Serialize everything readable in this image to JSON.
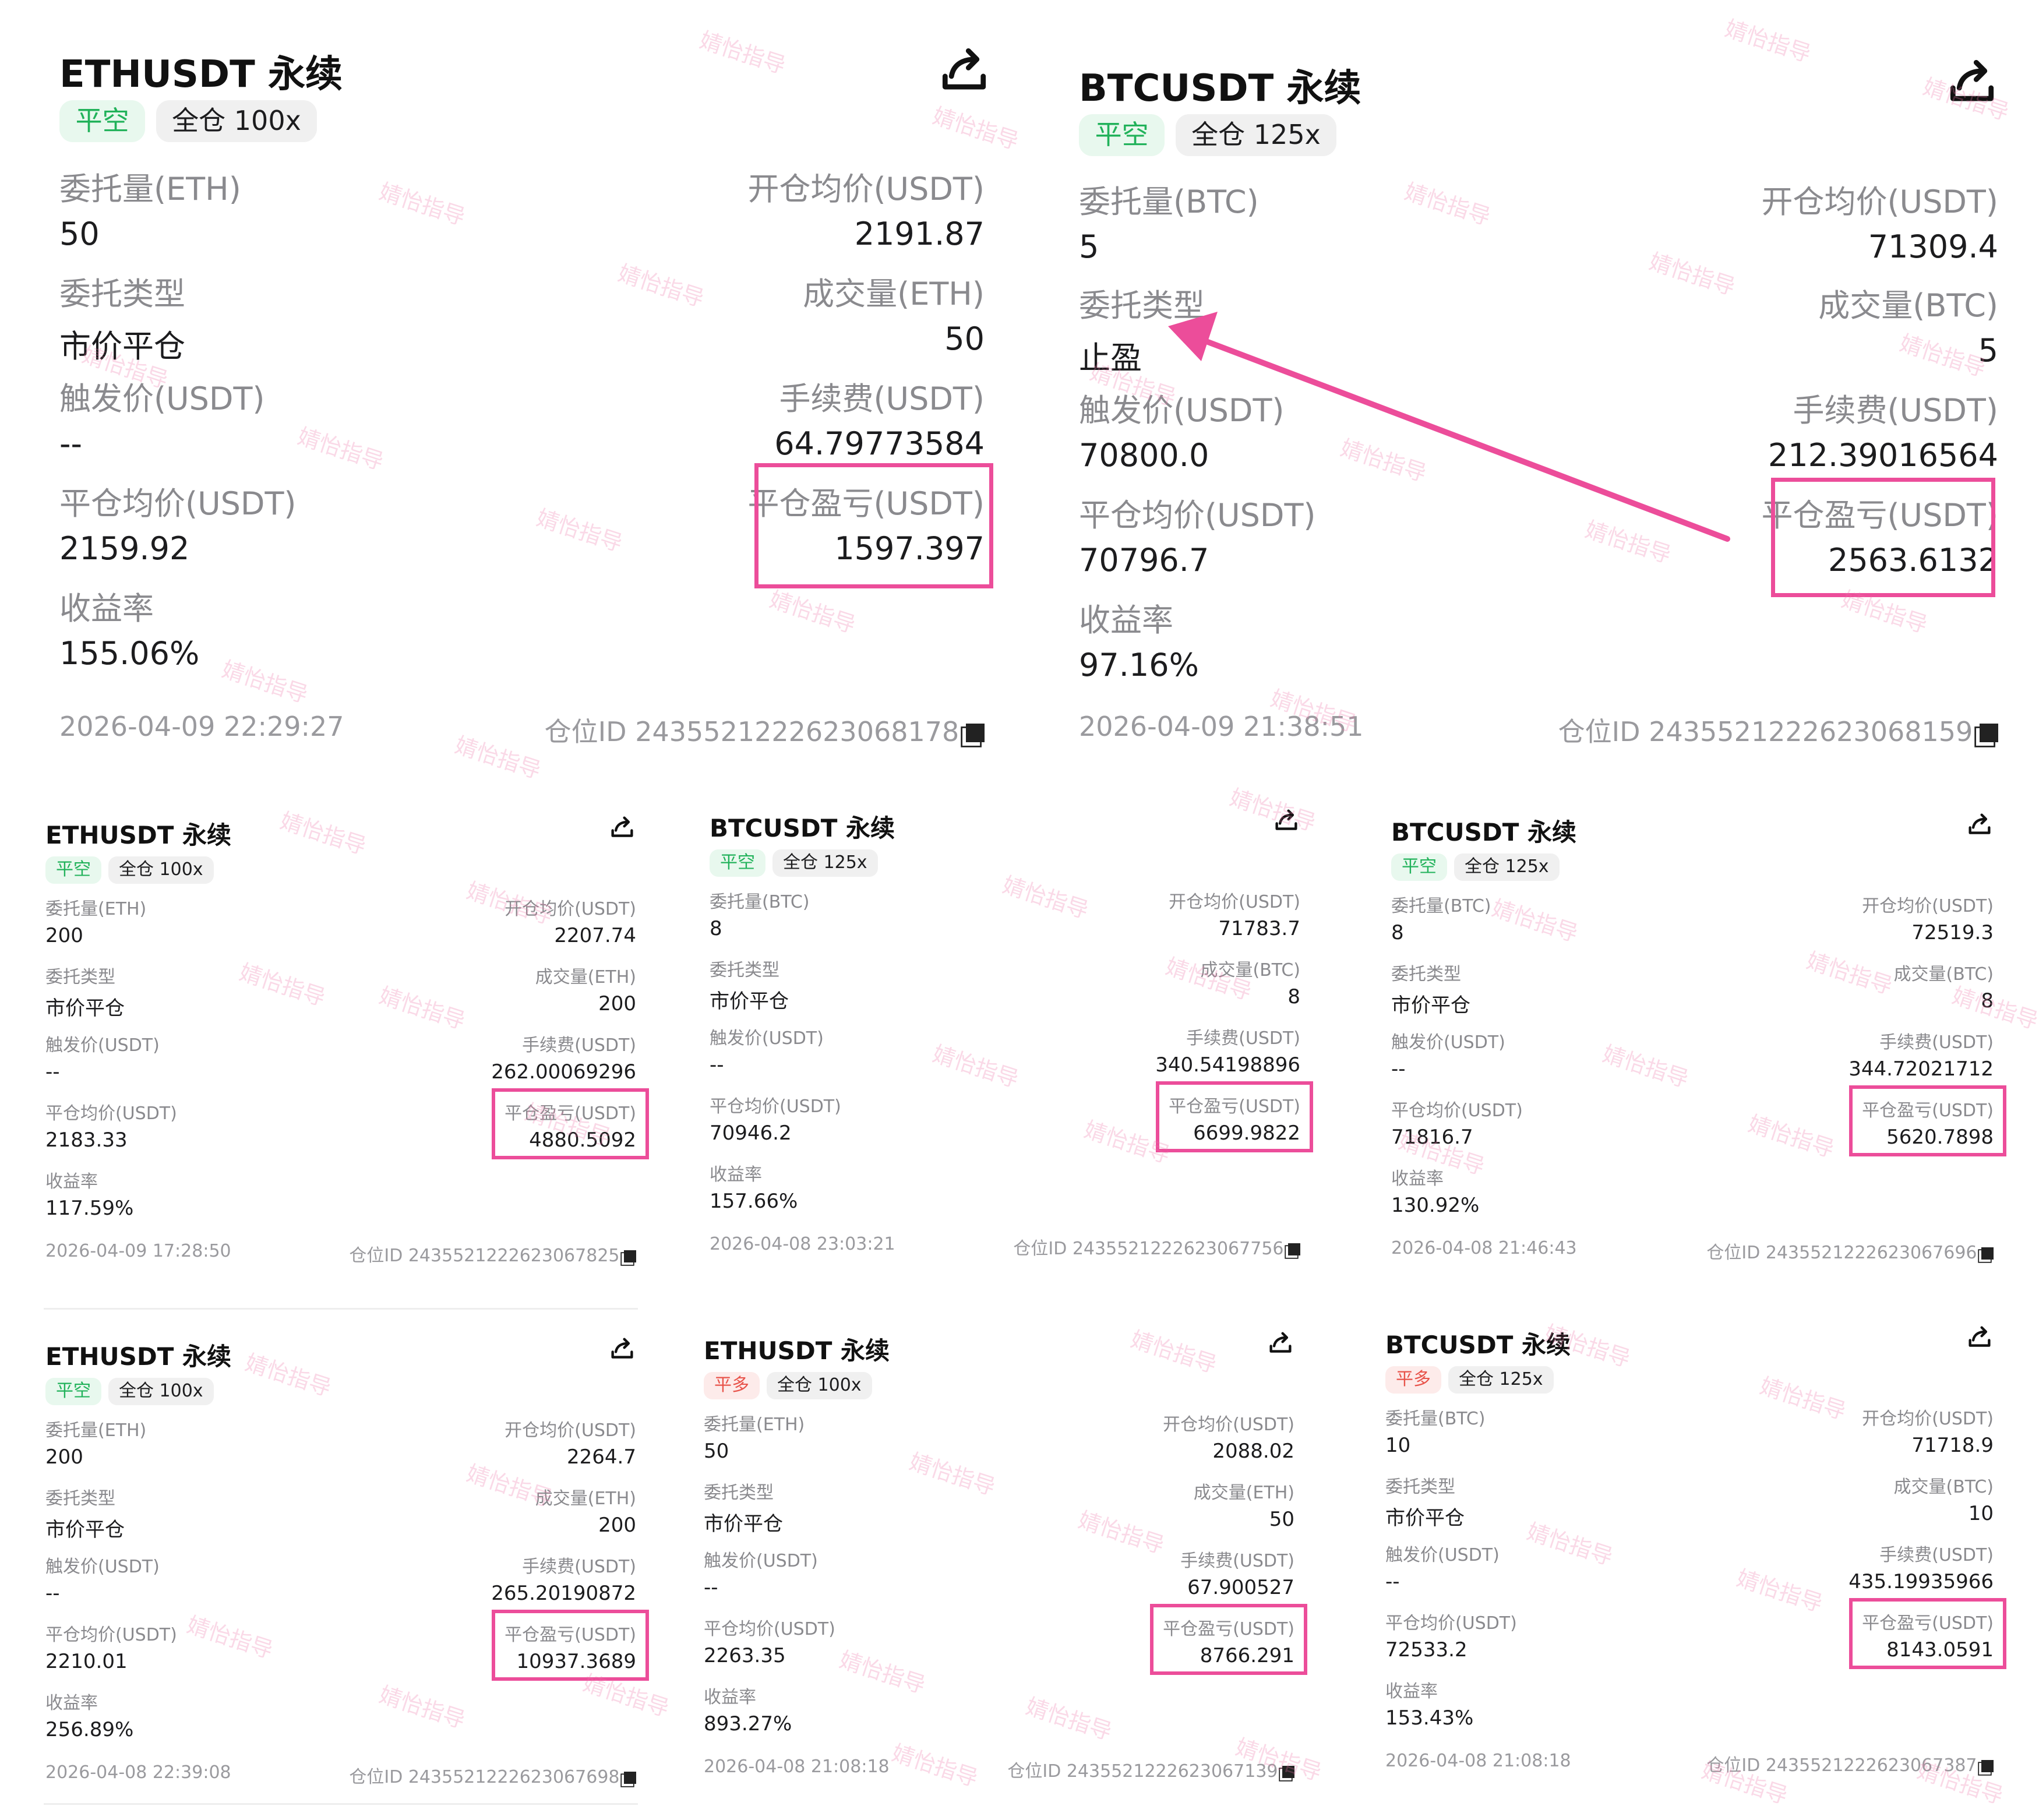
{
  "common": {
    "labels": {
      "qty_eth": "委托量(ETH)",
      "qty_btc": "委托量(BTC)",
      "order_type": "委托类型",
      "trigger_price": "触发价(USDT)",
      "close_avg": "平仓均价(USDT)",
      "roi": "收益率",
      "open_avg": "开仓均价(USDT)",
      "filled_eth": "成交量(ETH)",
      "filled_btc": "成交量(BTC)",
      "fee": "手续费(USDT)",
      "pnl": "平仓盈亏(USDT)"
    },
    "position_id_prefix": "仓位ID",
    "watermark": "婧怡指导",
    "colors": {
      "highlight": "#ec4d9a",
      "short_green": "#21b25a",
      "long_red": "#e8534a"
    },
    "icons": [
      "share-icon",
      "copy-icon",
      "arrow-annotation"
    ]
  },
  "cards": [
    {
      "title": "ETHUSDT 永续",
      "side": "平空",
      "margin": "全仓 100x",
      "qty": "50",
      "order_type": "市价平仓",
      "trigger": "--",
      "close_avg": "2159.92",
      "roi": "155.06%",
      "open_avg": "2191.87",
      "filled": "50",
      "fee": "64.79773584",
      "pnl": "1597.397",
      "timestamp": "2026-04-09 22:29:27",
      "position_id": "2435521222623068178"
    },
    {
      "title": "BTCUSDT 永续",
      "side": "平空",
      "margin": "全仓 125x",
      "qty": "5",
      "order_type": "止盈",
      "trigger": "70800.0",
      "close_avg": "70796.7",
      "roi": "97.16%",
      "open_avg": "71309.4",
      "filled": "5",
      "fee": "212.39016564",
      "pnl": "2563.6132",
      "timestamp": "2026-04-09 21:38:51",
      "position_id": "2435521222623068159"
    },
    {
      "title": "ETHUSDT 永续",
      "side": "平空",
      "margin": "全仓 100x",
      "qty": "200",
      "order_type": "市价平仓",
      "trigger": "--",
      "close_avg": "2183.33",
      "roi": "117.59%",
      "open_avg": "2207.74",
      "filled": "200",
      "fee": "262.00069296",
      "pnl": "4880.5092",
      "timestamp": "2026-04-09 17:28:50",
      "position_id": "2435521222623067825"
    },
    {
      "title": "BTCUSDT 永续",
      "side": "平空",
      "margin": "全仓 125x",
      "qty": "8",
      "order_type": "市价平仓",
      "trigger": "--",
      "close_avg": "70946.2",
      "roi": "157.66%",
      "open_avg": "71783.7",
      "filled": "8",
      "fee": "340.54198896",
      "pnl": "6699.9822",
      "timestamp": "2026-04-08 23:03:21",
      "position_id": "2435521222623067756"
    },
    {
      "title": "BTCUSDT 永续",
      "side": "平空",
      "margin": "全仓 125x",
      "qty": "8",
      "order_type": "市价平仓",
      "trigger": "--",
      "close_avg": "71816.7",
      "roi": "130.92%",
      "open_avg": "72519.3",
      "filled": "8",
      "fee": "344.72021712",
      "pnl": "5620.7898",
      "timestamp": "2026-04-08 21:46:43",
      "position_id": "2435521222623067696"
    },
    {
      "title": "ETHUSDT 永续",
      "side": "平空",
      "margin": "全仓 100x",
      "qty": "200",
      "order_type": "市价平仓",
      "trigger": "--",
      "close_avg": "2210.01",
      "roi": "256.89%",
      "open_avg": "2264.7",
      "filled": "200",
      "fee": "265.20190872",
      "pnl": "10937.3689",
      "timestamp": "2026-04-08 22:39:08",
      "position_id": "2435521222623067698"
    },
    {
      "title": "ETHUSDT 永续",
      "side": "平多",
      "margin": "全仓 100x",
      "qty": "50",
      "order_type": "市价平仓",
      "trigger": "--",
      "close_avg": "2263.35",
      "roi": "893.27%",
      "open_avg": "2088.02",
      "filled": "50",
      "fee": "67.900527",
      "pnl": "8766.291",
      "timestamp": "2026-04-08 21:08:18",
      "position_id": "2435521222623067139"
    },
    {
      "title": "BTCUSDT 永续",
      "side": "平多",
      "margin": "全仓 125x",
      "qty": "10",
      "order_type": "市价平仓",
      "trigger": "--",
      "close_avg": "72533.2",
      "roi": "153.43%",
      "open_avg": "71718.9",
      "filled": "10",
      "fee": "435.19935966",
      "pnl": "8143.0591",
      "timestamp": "2026-04-08 21:08:18",
      "position_id": "2435521222623067387"
    }
  ]
}
